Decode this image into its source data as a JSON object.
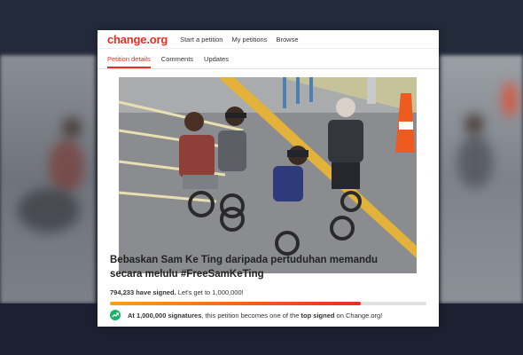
{
  "site": {
    "logo": "change.org"
  },
  "nav": [
    "Start a petition",
    "My petitions",
    "Browse"
  ],
  "tabs": [
    {
      "label": "Petition details",
      "active": true
    },
    {
      "label": "Comments",
      "active": false
    },
    {
      "label": "Updates",
      "active": false
    }
  ],
  "petition": {
    "title": "Bebaskan Sam Ke Ting daripada pertuduhan memandu secara melulu #FreeSamKeTing",
    "signed_count": "794,233",
    "signed_suffix": " have signed.",
    "goal_text": " Let's get to 1,000,000!",
    "progress_fraction": 0.794
  },
  "milestone": {
    "bold1": "At 1,000,000 signatures",
    "mid": ", this petition becomes one of the ",
    "bold2": "top signed",
    "end": " on Change.org!"
  },
  "colors": {
    "brand": "#ec2c22",
    "progress_start": "#f7a21b",
    "milestone_icon": "#1db16c"
  },
  "icons": {
    "milestone": "trending-up-icon"
  }
}
